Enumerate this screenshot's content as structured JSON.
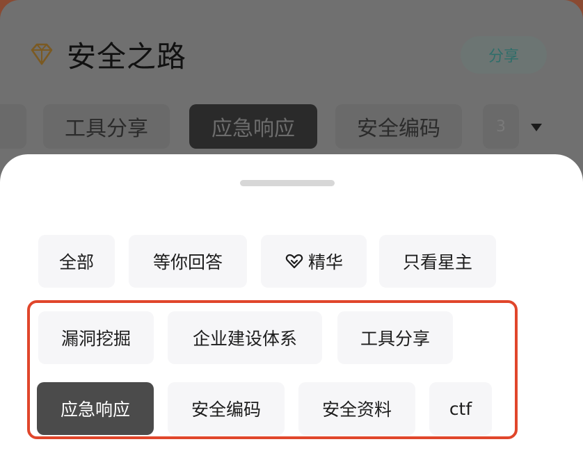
{
  "group": {
    "title": "安全之路",
    "icon": "diamond-icon"
  },
  "share_button": {
    "label": "分享"
  },
  "top_tabs": [
    {
      "label": "工具分享",
      "active": false
    },
    {
      "label": "应急响应",
      "active": true
    },
    {
      "label": "安全编码",
      "active": false
    }
  ],
  "tab_partial_right": "3",
  "sheet": {
    "row1": [
      {
        "label": "全部"
      },
      {
        "label": "等你回答"
      },
      {
        "label": "精华",
        "icon": "heart-icon"
      },
      {
        "label": "只看星主"
      }
    ],
    "row2": [
      {
        "label": "漏洞挖掘"
      },
      {
        "label": "企业建设体系"
      },
      {
        "label": "工具分享"
      }
    ],
    "row3": [
      {
        "label": "应急响应",
        "active": true
      },
      {
        "label": "安全编码"
      },
      {
        "label": "安全资料"
      },
      {
        "label": "ctf"
      }
    ]
  },
  "colors": {
    "highlight_border": "#e0462b",
    "active_chip": "#4b4b4b",
    "share_text": "#2f6e6a"
  }
}
